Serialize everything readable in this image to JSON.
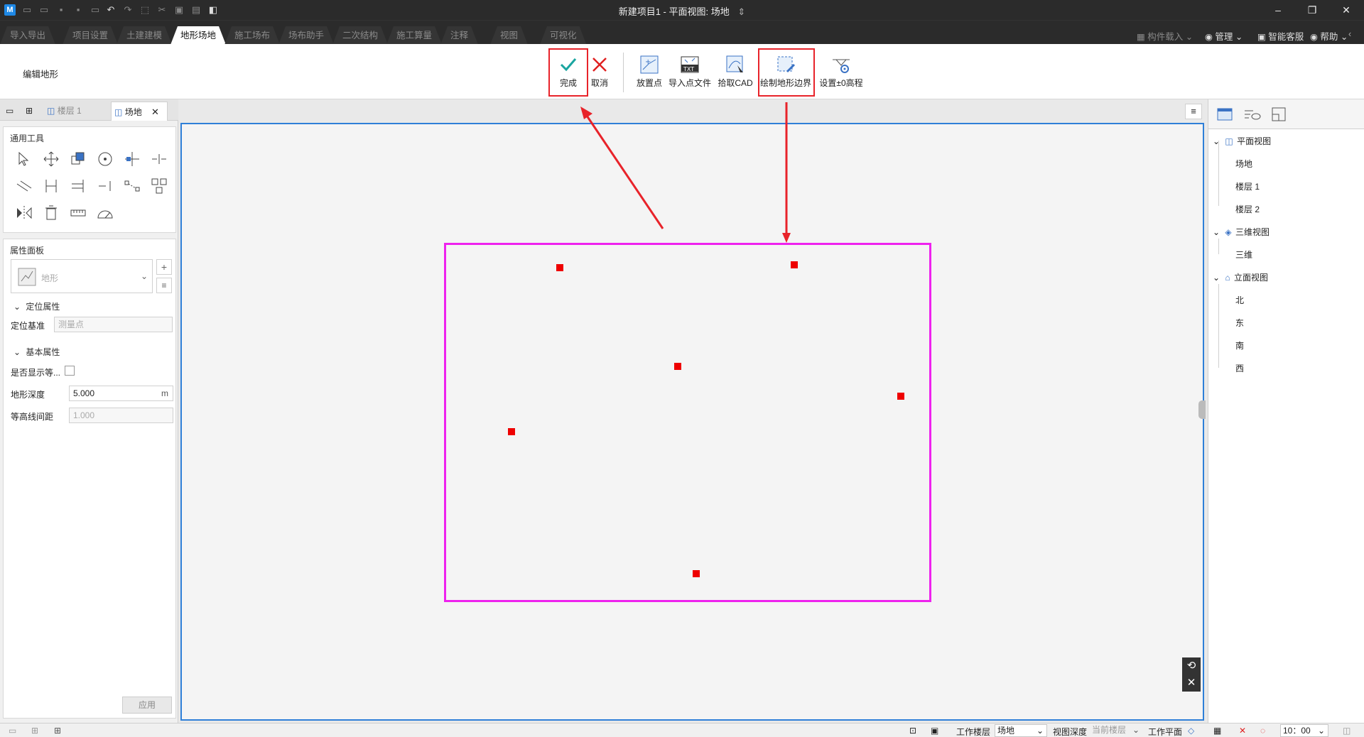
{
  "window": {
    "app_icon": "M",
    "title": "新建项目1 - 平面视图: 场地",
    "title_arrow": "⇕",
    "minimize": "–",
    "restore": "❐",
    "close": "✕"
  },
  "quick_access": [
    "new-icon",
    "open-icon",
    "save-icon",
    "save-as-icon",
    "print-icon",
    "undo-icon",
    "redo-icon",
    "select-icon",
    "cut-icon",
    "copy-icon",
    "paste-icon",
    "cube-icon"
  ],
  "tabs": [
    {
      "label": "导入导出",
      "active": false
    },
    {
      "label": "项目设置",
      "active": false
    },
    {
      "label": "土建建模",
      "active": false
    },
    {
      "label": "地形场地",
      "active": true
    },
    {
      "label": "施工场布",
      "active": false
    },
    {
      "label": "场布助手",
      "active": false
    },
    {
      "label": "二次结构",
      "active": false
    },
    {
      "label": "施工算量",
      "active": false
    },
    {
      "label": "注释",
      "active": false
    },
    {
      "label": "视图",
      "active": false
    },
    {
      "label": "可视化",
      "active": false
    }
  ],
  "tab_right": {
    "component_load": "构件载入",
    "manage": "管理",
    "support": "智能客服",
    "help": "帮助"
  },
  "ribbon": {
    "group_label": "编辑地形",
    "finish": "完成",
    "cancel": "取消",
    "place_point": "放置点",
    "import_points": "导入点文件",
    "pick_cad": "拾取CAD",
    "draw_boundary": "绘制地形边界",
    "set_elevation": "设置±0高程",
    "txt_badge": "TXT"
  },
  "left_panel": {
    "doc_tabs": [
      {
        "label": "楼层 1",
        "active": false
      },
      {
        "label": "场地",
        "active": true
      }
    ],
    "tools_title": "通用工具",
    "props_title": "属性面板",
    "type_selector": "地形",
    "positioning_header": "定位属性",
    "position_base_label": "定位基准",
    "position_base_placeholder": "测量点",
    "basic_header": "基本属性",
    "show_contour_label": "是否显示等...",
    "terrain_depth_label": "地形深度",
    "terrain_depth_value": "5.000",
    "terrain_depth_unit": "m",
    "contour_spacing_label": "等高线间距",
    "contour_spacing_value": "1.000",
    "apply": "应用"
  },
  "canvas": {
    "menu_icon": "≡",
    "points": [
      {
        "x": 0.233,
        "y": 0.06
      },
      {
        "x": 0.713,
        "y": 0.052
      },
      {
        "x": 0.474,
        "y": 0.278
      },
      {
        "x": 0.932,
        "y": 0.346
      },
      {
        "x": 0.133,
        "y": 0.425
      },
      {
        "x": 0.513,
        "y": 0.746
      }
    ],
    "boundary_color": "#ee22ee",
    "point_color": "#ee0000"
  },
  "project_tree": {
    "groups": [
      {
        "label": "平面视图",
        "items": [
          "场地",
          "楼层 1",
          "楼层 2"
        ]
      },
      {
        "label": "三维视图",
        "items": [
          "三维"
        ]
      },
      {
        "label": "立面视图",
        "items": [
          "北",
          "东",
          "南",
          "西"
        ]
      }
    ]
  },
  "statusbar": {
    "work_floor_label": "工作楼层",
    "work_floor_value": "场地",
    "view_depth_label": "视图深度",
    "view_depth_value": "当前楼层",
    "work_plane_label": "工作平面",
    "scale_value": "10：00"
  },
  "colors": {
    "accent": "#2f7fd8",
    "highlight_box": "#e8232a",
    "finish_check": "#1aa5a0",
    "cancel_x": "#e02020"
  }
}
